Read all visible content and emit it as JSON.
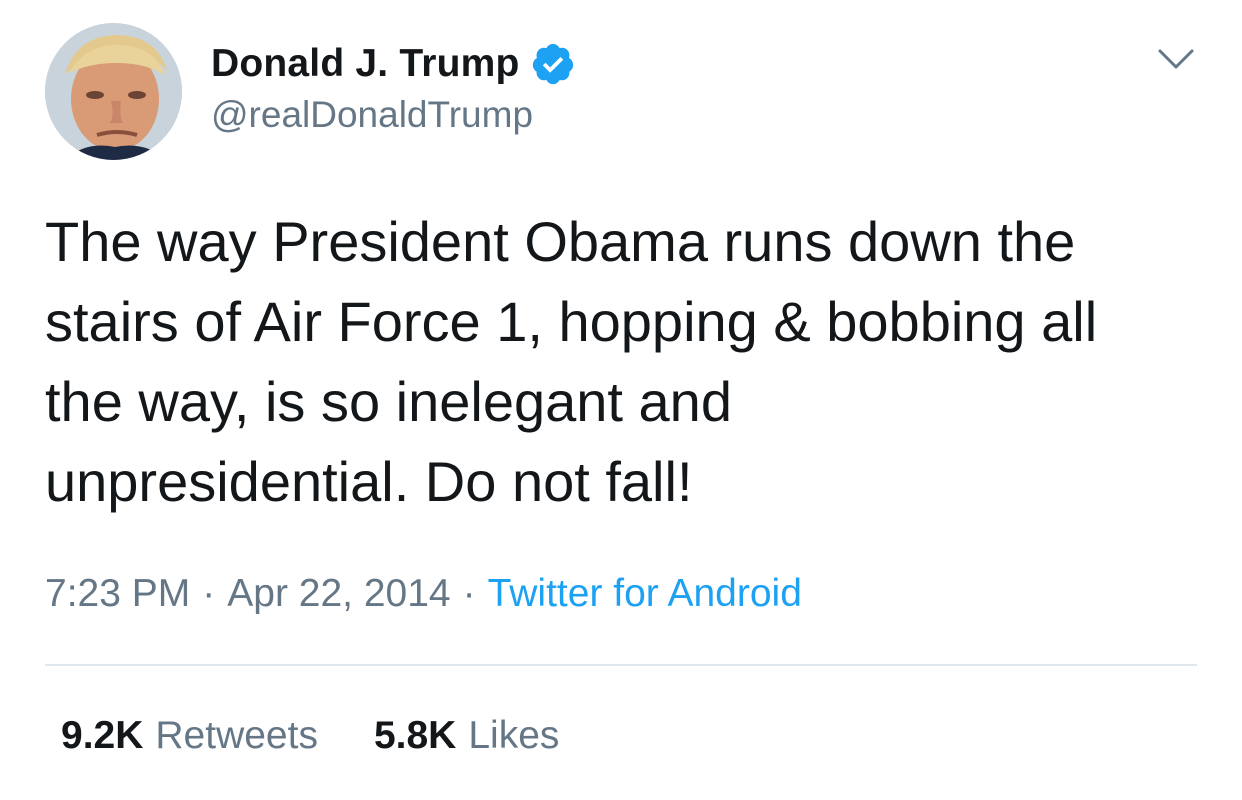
{
  "tweet": {
    "display_name": "Donald J. Trump",
    "handle": "@realDonaldTrump",
    "verified_icon": "verified-badge-icon",
    "text": "The way President Obama runs down the\nstairs of Air Force 1, hopping & bobbing all\nthe way, is so inelegant and\nunpresidential. Do not fall!",
    "time": "7:23 PM",
    "separator": "·",
    "date": "Apr 22, 2014",
    "source": "Twitter for Android",
    "stats": {
      "retweets_count": "9.2K",
      "retweets_label": "Retweets",
      "likes_count": "5.8K",
      "likes_label": "Likes"
    }
  },
  "colors": {
    "text_primary": "#14171a",
    "text_secondary": "#657786",
    "link": "#1da1f2",
    "divider": "#e1e8ed",
    "verified": "#1da1f2"
  }
}
